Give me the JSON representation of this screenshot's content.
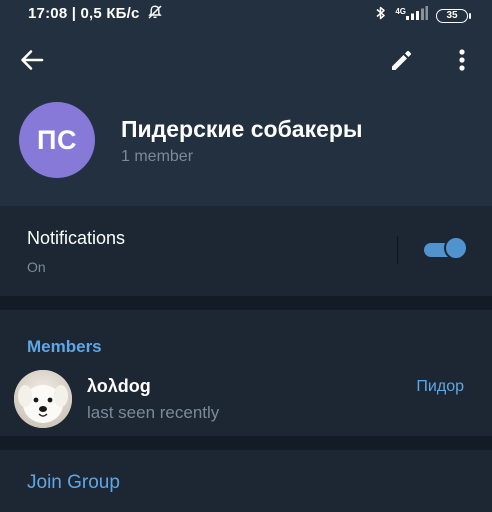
{
  "status_bar": {
    "time_speed": "17:08 | 0,5 КБ/с",
    "network_type": "4G",
    "battery": "35",
    "icons": [
      "do-not-disturb-icon",
      "bluetooth-icon",
      "signal-icon",
      "battery-icon"
    ]
  },
  "header": {
    "icons": [
      "back-arrow-icon",
      "pencil-icon",
      "more-vertical-icon"
    ],
    "avatar_initials": "ПС",
    "avatar_color": "#8779d8",
    "group_name": "Пидерские собакеры",
    "member_count": "1 member"
  },
  "notifications": {
    "title": "Notifications",
    "state_label": "On",
    "enabled": true,
    "toggle_color": "#4f93cf"
  },
  "members": {
    "heading": "Members",
    "list": [
      {
        "name": "λολdog",
        "status": "last seen recently",
        "role": "Пидор",
        "avatar": "dog-photo"
      }
    ]
  },
  "join": {
    "label": "Join Group"
  },
  "colors": {
    "accent": "#5ea7e6",
    "background": "#131c26",
    "section": "#1d2733",
    "header": "#23303f",
    "secondary_text": "#7b8a98"
  }
}
